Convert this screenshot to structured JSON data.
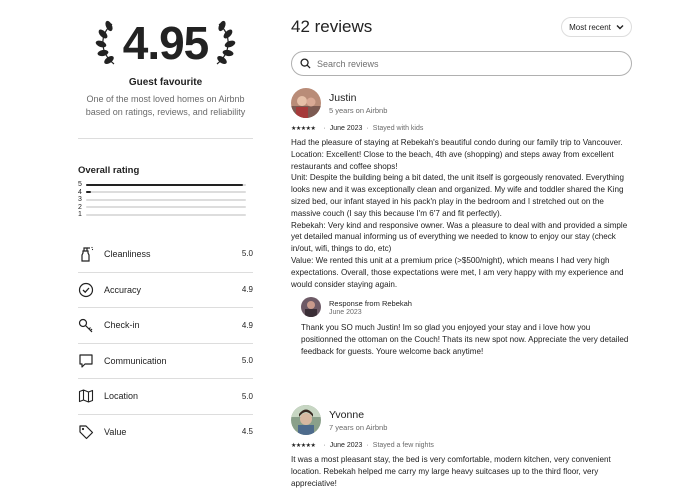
{
  "summary": {
    "score": "4.95",
    "title": "Guest favourite",
    "description": "One of the most loved homes on Airbnb based on ratings, reviews, and reliability"
  },
  "overall": {
    "title": "Overall rating",
    "bars": [
      {
        "label": "5",
        "fraction": 0.98
      },
      {
        "label": "4",
        "fraction": 0.03
      },
      {
        "label": "3",
        "fraction": 0.0
      },
      {
        "label": "2",
        "fraction": 0.0
      },
      {
        "label": "1",
        "fraction": 0.0
      }
    ]
  },
  "categories": [
    {
      "label": "Cleanliness",
      "value": "5.0",
      "icon": "spray-bottle-icon"
    },
    {
      "label": "Accuracy",
      "value": "4.9",
      "icon": "check-circle-icon"
    },
    {
      "label": "Check-in",
      "value": "4.9",
      "icon": "key-icon"
    },
    {
      "label": "Communication",
      "value": "5.0",
      "icon": "chat-bubble-icon"
    },
    {
      "label": "Location",
      "value": "5.0",
      "icon": "map-icon"
    },
    {
      "label": "Value",
      "value": "4.5",
      "icon": "tag-icon"
    }
  ],
  "reviews_header": {
    "title": "42 reviews",
    "sort_label": "Most recent",
    "search_placeholder": "Search reviews"
  },
  "reviews": [
    {
      "name": "Justin",
      "meta": "5 years on Airbnb",
      "stars": "★★★★★",
      "date": "June 2023",
      "stay": "Stayed with kids",
      "text": "Had the pleasure of staying at Rebekah's beautiful condo during our family trip to Vancouver.\nLocation: Excellent! Close to the beach, 4th ave (shopping) and steps away from excellent restaurants and coffee shops!\nUnit: Despite the building being a bit dated, the unit itself is gorgeously renovated. Everything looks new and it was exceptionally clean and organized. My wife and toddler shared the King sized bed, our infant stayed in his pack'n play in the bedroom and I stretched out on the massive couch (I say this because I'm 6'7 and fit perfectly).\nRebekah: Very kind and responsive owner. Was a pleasure to deal with and provided a simple yet detailed manual informing us of everything we needed to know to enjoy our stay (check in/out, wifi, things to do, etc)\nValue: We rented this unit at a premium price (>$500/night), which means I had very high expectations. Overall, those expectations were met, I am very happy with my experience and would consider staying again.",
      "response": {
        "title": "Response from Rebekah",
        "date": "June 2023",
        "text": "Thank you SO much Justin! Im so glad you enjoyed your stay and i love how you positionned the ottoman on the Couch! Thats its new spot now. Appreciate the very detailed feedback for guests. Youre welcome back anytime!"
      }
    },
    {
      "name": "Yvonne",
      "meta": "7 years on Airbnb",
      "stars": "★★★★★",
      "date": "June 2023",
      "stay": "Stayed a few nights",
      "text": "It was a most pleasant stay, the bed is very comfortable, modern kitchen, very convenient location. Rebekah helped me carry my large heavy suitcases up to the third floor, very appreciative!"
    }
  ]
}
